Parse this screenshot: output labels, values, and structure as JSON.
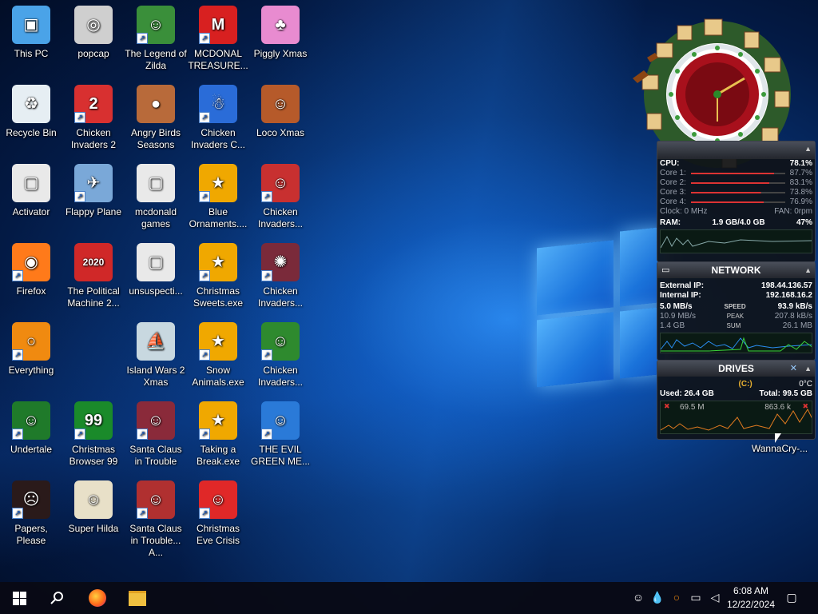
{
  "desktop_icons": [
    {
      "label": "This PC",
      "color": "#4aa3e8",
      "glyph": "▣",
      "shortcut": false
    },
    {
      "label": "popcap",
      "color": "#cfcfcf",
      "glyph": "◎",
      "shortcut": false
    },
    {
      "label": "The Legend of Zilda",
      "color": "#3a8f3a",
      "glyph": "☺",
      "shortcut": true
    },
    {
      "label": "MCDONAL TREASURE...",
      "color": "#d82020",
      "glyph": "M",
      "shortcut": true
    },
    {
      "label": "Piggly Xmas",
      "color": "#e88bd0",
      "glyph": "♣",
      "shortcut": false
    },
    {
      "label": "Recycle Bin",
      "color": "#e6eef3",
      "glyph": "♻",
      "shortcut": false
    },
    {
      "label": "Chicken Invaders 2",
      "color": "#d83030",
      "glyph": "2",
      "shortcut": true
    },
    {
      "label": "Angry Birds Seasons",
      "color": "#b86a3a",
      "glyph": "●",
      "shortcut": false
    },
    {
      "label": "Chicken Invaders C...",
      "color": "#2a6cd8",
      "glyph": "☃",
      "shortcut": true
    },
    {
      "label": "Loco Xmas",
      "color": "#b65a2a",
      "glyph": "☺",
      "shortcut": false
    },
    {
      "label": "Activator",
      "color": "#e9e9e9",
      "glyph": "▢",
      "shortcut": false
    },
    {
      "label": "Flappy Plane",
      "color": "#7aa8d8",
      "glyph": "✈",
      "shortcut": true
    },
    {
      "label": "mcdonald games",
      "color": "#e9e9e9",
      "glyph": "▢",
      "shortcut": false
    },
    {
      "label": "Blue Ornaments....",
      "color": "#f0a800",
      "glyph": "★",
      "shortcut": true
    },
    {
      "label": "Chicken Invaders...",
      "color": "#c83030",
      "glyph": "☺",
      "shortcut": true
    },
    {
      "label": "Firefox",
      "color": "#ff7a1a",
      "glyph": "◉",
      "shortcut": true
    },
    {
      "label": "The Political Machine 2...",
      "color": "#d02828",
      "glyph": "2020",
      "shortcut": false
    },
    {
      "label": "unsuspecti...",
      "color": "#e9e9e9",
      "glyph": "▢",
      "shortcut": false
    },
    {
      "label": "Christmas Sweets.exe",
      "color": "#f0a800",
      "glyph": "★",
      "shortcut": true
    },
    {
      "label": "Chicken Invaders...",
      "color": "#7a2a3a",
      "glyph": "✺",
      "shortcut": true
    },
    {
      "label": "Everything",
      "color": "#f08a10",
      "glyph": "○",
      "shortcut": true
    },
    {
      "label": "",
      "color": "",
      "glyph": "",
      "shortcut": false
    },
    {
      "label": "Island Wars 2 Xmas",
      "color": "#c8d8e0",
      "glyph": "⛵",
      "shortcut": false
    },
    {
      "label": "Snow Animals.exe",
      "color": "#f0a800",
      "glyph": "★",
      "shortcut": true
    },
    {
      "label": "Chicken Invaders...",
      "color": "#2e8a2e",
      "glyph": "☺",
      "shortcut": true
    },
    {
      "label": "Undertale",
      "color": "#1f7a2a",
      "glyph": "☺",
      "shortcut": true
    },
    {
      "label": "Christmas Browser 99",
      "color": "#1a8a2a",
      "glyph": "99",
      "shortcut": true
    },
    {
      "label": "Santa Claus in Trouble",
      "color": "#8a2a3a",
      "glyph": "☺",
      "shortcut": true
    },
    {
      "label": "Taking a Break.exe",
      "color": "#f0a800",
      "glyph": "★",
      "shortcut": true
    },
    {
      "label": "THE EVIL GREEN ME...",
      "color": "#2a7ad8",
      "glyph": "☺",
      "shortcut": true
    },
    {
      "label": "Papers, Please",
      "color": "#2a1a1a",
      "glyph": "☹",
      "shortcut": true
    },
    {
      "label": "Super Hilda",
      "color": "#e8e0c8",
      "glyph": "☺",
      "shortcut": false
    },
    {
      "label": "Santa Claus in Trouble... A...",
      "color": "#b03030",
      "glyph": "☺",
      "shortcut": true
    },
    {
      "label": "Christmas Eve Crisis",
      "color": "#e02828",
      "glyph": "☺",
      "shortcut": true
    }
  ],
  "extra_icon": {
    "label": "WannaCry-...",
    "color": "#6a6a6a",
    "glyph": "☠"
  },
  "cpu": {
    "title": "CPU:",
    "total": "78.1%",
    "cores": [
      {
        "label": "Core 1:",
        "value": "87.7%",
        "level": 0.877
      },
      {
        "label": "Core 2:",
        "value": "83.1%",
        "level": 0.831
      },
      {
        "label": "Core 3:",
        "value": "73.8%",
        "level": 0.738
      },
      {
        "label": "Core 4:",
        "value": "76.9%",
        "level": 0.769
      }
    ],
    "clock": "Clock: 0 MHz",
    "fan": "FAN: 0rpm",
    "ram_label": "RAM:",
    "ram_value": "1.9 GB/4.0 GB",
    "ram_pct": "47%"
  },
  "network": {
    "title": "NETWORK",
    "external_label": "External IP:",
    "external": "198.44.136.57",
    "internal_label": "Internal IP:",
    "internal": "192.168.16.2",
    "row1_left": "5.0 MB/s",
    "row1_mid": "SPEED",
    "row1_right": "93.9 kB/s",
    "row2_left": "10.9 MB/s",
    "row2_mid": "PEAK",
    "row2_right": "207.8 kB/s",
    "row3_left": "1.4 GB",
    "row3_mid": "SUM",
    "row3_right": "26.1 MB"
  },
  "drives": {
    "title": "DRIVES",
    "drive": "(C:)",
    "temp": "0°C",
    "used": "Used: 26.4 GB",
    "total": "Total: 99.5 GB",
    "read": "69.5 M",
    "write": "863.6 k"
  },
  "taskbar": {
    "time": "6:08 AM",
    "date": "12/22/2024"
  }
}
